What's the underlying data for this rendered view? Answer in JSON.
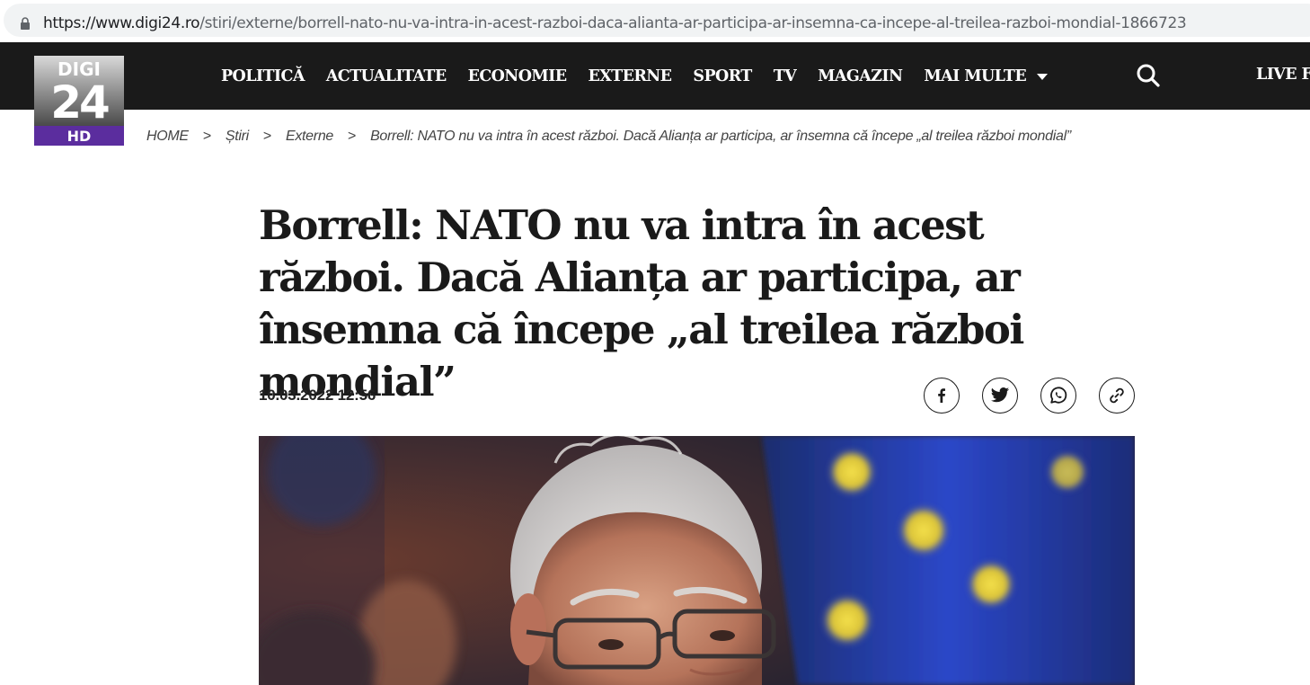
{
  "browser": {
    "url_host": "https://www.digi24.ro",
    "url_path": "/stiri/externe/borrell-nato-nu-va-intra-in-acest-razboi-daca-alianta-ar-participa-ar-insemna-ca-incepe-al-treilea-razboi-mondial-1866723"
  },
  "logo": {
    "line1": "DIGI",
    "line2": "24",
    "line3": "HD"
  },
  "nav": {
    "items": [
      "POLITICĂ",
      "ACTUALITATE",
      "ECONOMIE",
      "EXTERNE",
      "SPORT",
      "TV",
      "MAGAZIN"
    ],
    "more_label": "MAI MULTE",
    "live_label": "LIVE F"
  },
  "breadcrumb": {
    "home": "HOME",
    "section": "Știri",
    "subsection": "Externe",
    "current": "Borrell: NATO nu va intra în acest război. Dacă Alianța ar participa, ar însemna că începe „al treilea război mondial”",
    "separator": ">"
  },
  "article": {
    "title": "Borrell: NATO nu va intra în acest război. Dacă Alianța ar participa, ar însemna că începe „al treilea război mondial”",
    "date": "10.03.2022 12:56"
  },
  "share": [
    "facebook-icon",
    "twitter-icon",
    "whatsapp-icon",
    "link-icon"
  ],
  "colors": {
    "nav_bg": "#1a1a1a",
    "logo_purple": "#5b2d9e",
    "text": "#1a1a1a"
  }
}
